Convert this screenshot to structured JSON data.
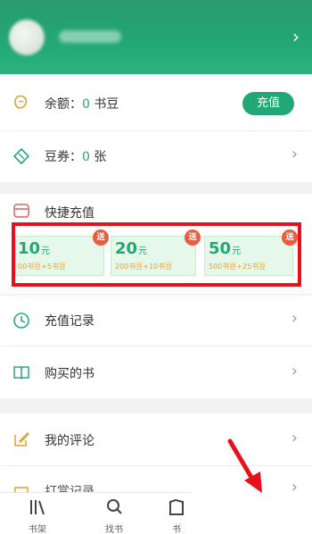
{
  "header": {
    "username": "",
    "chevron": "›"
  },
  "account": {
    "balance_prefix": "余额：",
    "balance_value": "0",
    "balance_unit": " 书豆",
    "recharge_label": "充值",
    "voucher_prefix": "豆券：",
    "voucher_value": "0",
    "voucher_unit": " 张"
  },
  "quick_recharge": {
    "title": "快捷充值",
    "cards": [
      {
        "amount": "10",
        "unit": "元",
        "desc": "00书豆+5书豆",
        "badge": "送"
      },
      {
        "amount": "20",
        "unit": "元",
        "desc": "200书豆+10书豆",
        "badge": "送"
      },
      {
        "amount": "50",
        "unit": "元",
        "desc": "500书豆+25书豆",
        "badge": "送"
      }
    ]
  },
  "menu": {
    "recharge_record": "充值记录",
    "purchased_books": "购买的书",
    "my_comments": "我的评论",
    "reward_record": "打赏记录"
  },
  "bottom_nav": [
    {
      "label": "书架",
      "icon": "bookshelf-icon"
    },
    {
      "label": "找书",
      "icon": "search-icon"
    },
    {
      "label": "书",
      "icon": "book-icon"
    }
  ],
  "colors": {
    "brand": "#22a877",
    "highlight_border": "#e8101a",
    "badge": "#ef5b3d",
    "annotation_arrow": "#e8101a"
  }
}
